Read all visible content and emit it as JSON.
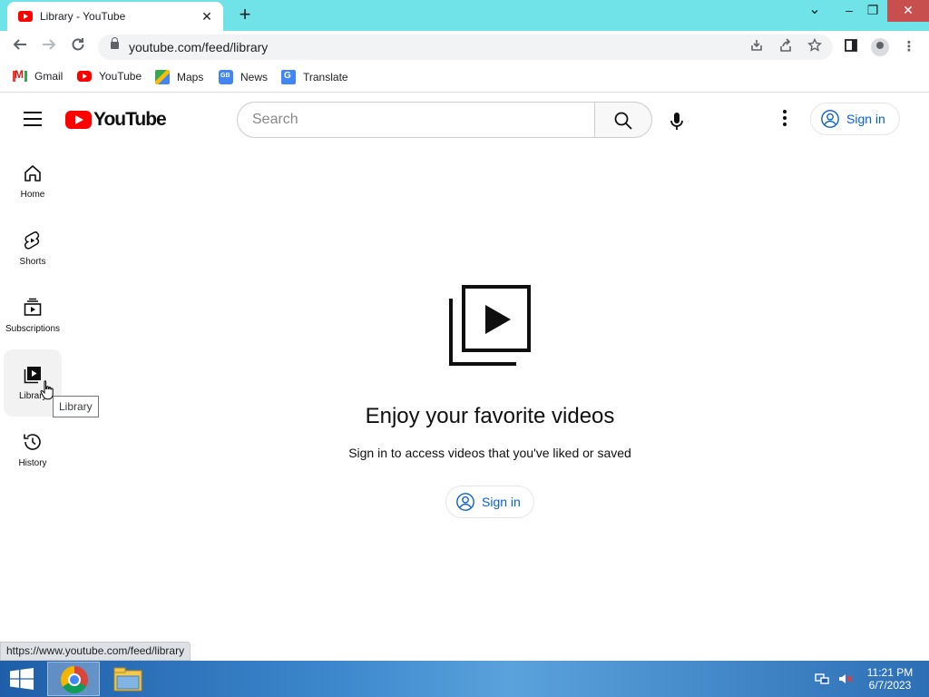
{
  "browser": {
    "tab_title": "Library - YouTube",
    "tab_close": "✕",
    "new_tab": "+",
    "url": "youtube.com/feed/library",
    "win_controls": {
      "chevron": "⌄",
      "minimize": "–",
      "restore": "❐",
      "close": "✕"
    },
    "bookmarks": [
      {
        "label": "Gmail",
        "icon": "gmail-icon"
      },
      {
        "label": "YouTube",
        "icon": "youtube-icon"
      },
      {
        "label": "Maps",
        "icon": "maps-icon"
      },
      {
        "label": "News",
        "icon": "news-icon"
      },
      {
        "label": "Translate",
        "icon": "translate-icon"
      }
    ],
    "status_url": "https://www.youtube.com/feed/library"
  },
  "youtube": {
    "logo_text": "YouTube",
    "search_placeholder": "Search",
    "sign_in_label": "Sign in",
    "sidebar": [
      {
        "label": "Home",
        "icon": "home-icon"
      },
      {
        "label": "Shorts",
        "icon": "shorts-icon"
      },
      {
        "label": "Subscriptions",
        "icon": "subscriptions-icon"
      },
      {
        "label": "Library",
        "icon": "library-icon",
        "active": true
      },
      {
        "label": "History",
        "icon": "history-icon"
      }
    ],
    "tooltip": "Library",
    "empty_state": {
      "title": "Enjoy your favorite videos",
      "subtitle": "Sign in to access videos that you've liked or saved",
      "button": "Sign in"
    }
  },
  "taskbar": {
    "time": "11:21 PM",
    "date": "6/7/2023"
  },
  "colors": {
    "tab_strip": "#6fe3e7",
    "accent_blue": "#065fd4",
    "youtube_red": "#ff0000"
  }
}
